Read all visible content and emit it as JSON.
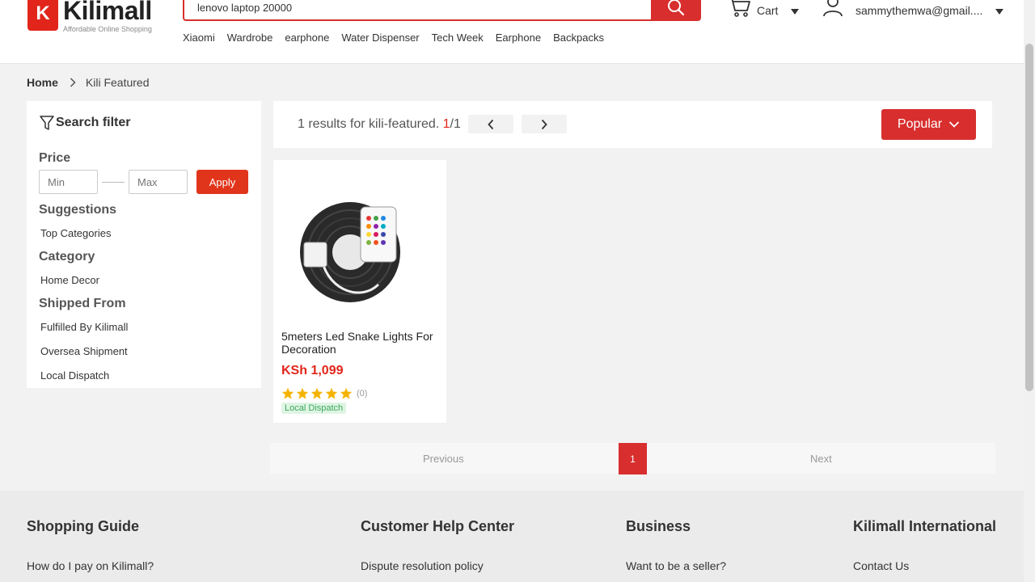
{
  "header": {
    "logo": {
      "letter": "K",
      "name": "Kilimall",
      "tagline": "Affordable Online Shopping"
    },
    "search": {
      "value": "lenovo laptop 20000",
      "placeholder": ""
    },
    "hot_links": [
      "Xiaomi",
      "Wardrobe",
      "earphone",
      "Water Dispenser",
      "Tech Week",
      "Earphone",
      "Backpacks"
    ],
    "cart_label": "Cart",
    "account_label": "sammythemwa@gmail...."
  },
  "breadcrumb": {
    "home": "Home",
    "current": "Kili Featured"
  },
  "sidebar": {
    "title": "Search filter",
    "price": {
      "title": "Price",
      "min_placeholder": "Min",
      "max_placeholder": "Max",
      "apply_label": "Apply"
    },
    "suggestions": {
      "title": "Suggestions",
      "items": [
        "Top Categories"
      ]
    },
    "category": {
      "title": "Category",
      "items": [
        "Home Decor"
      ]
    },
    "shipped_from": {
      "title": "Shipped From",
      "items": [
        "Fulfilled By Kilimall",
        "Oversea Shipment",
        "Local Dispatch"
      ]
    }
  },
  "results": {
    "text": "1 results for kili-featured.",
    "current_page": "1",
    "page_sep": "/",
    "total_pages": "1",
    "sort_label": "Popular"
  },
  "products": [
    {
      "name": "5meters Led Snake Lights For Decoration",
      "price": "KSh 1,099",
      "rating": 5,
      "reviews": "(0)",
      "badge": "Local Dispatch"
    }
  ],
  "pagination": {
    "prev": "Previous",
    "page": "1",
    "next": "Next"
  },
  "footer": {
    "columns": [
      {
        "title": "Shopping Guide",
        "link": "How do I pay on Kilimall?"
      },
      {
        "title": "Customer Help Center",
        "link": "Dispute resolution policy"
      },
      {
        "title": "Business",
        "link": "Want to be a seller?"
      },
      {
        "title": "Kilimall International",
        "link": "Contact Us"
      }
    ]
  },
  "colors": {
    "brand_red": "#d82e2e",
    "star": "#f5b301",
    "badge_green": "#3aa85a"
  }
}
